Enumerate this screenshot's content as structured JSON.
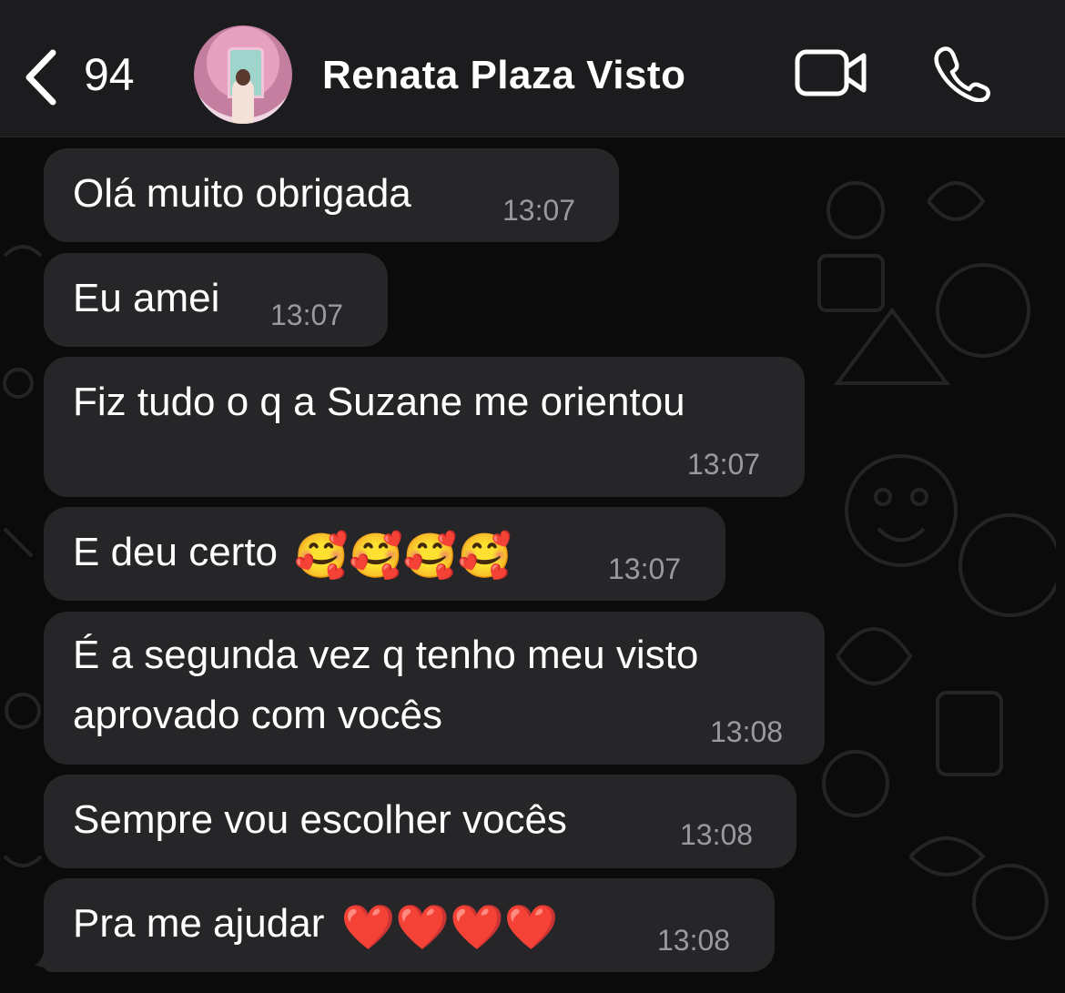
{
  "header": {
    "unread_count": "94",
    "contact_name": "Renata Plaza Visto"
  },
  "messages": [
    {
      "text": "Olá muito obrigada",
      "time": "13:07"
    },
    {
      "text": "Eu amei",
      "time": "13:07"
    },
    {
      "text": "Fiz tudo o q a Suzane me orientou",
      "time": "13:07"
    },
    {
      "text": "E deu certo",
      "emoji": "🥰🥰🥰🥰",
      "time": "13:07"
    },
    {
      "text_line1": "É a segunda vez q tenho meu visto",
      "text_line2": "aprovado com vocês",
      "time": "13:08"
    },
    {
      "text": "Sempre vou escolher vocês",
      "time": "13:08"
    },
    {
      "text": "Pra me ajudar",
      "emoji": "❤️❤️❤️❤️",
      "time": "13:08"
    }
  ],
  "colors": {
    "header_bg": "#1c1c1e",
    "bubble_bg": "#262628",
    "time_text": "#9a9a9e",
    "wallpaper_bg": "#0b0b0b"
  },
  "icons": [
    "chevron-left-icon",
    "video-camera-icon",
    "phone-icon"
  ]
}
